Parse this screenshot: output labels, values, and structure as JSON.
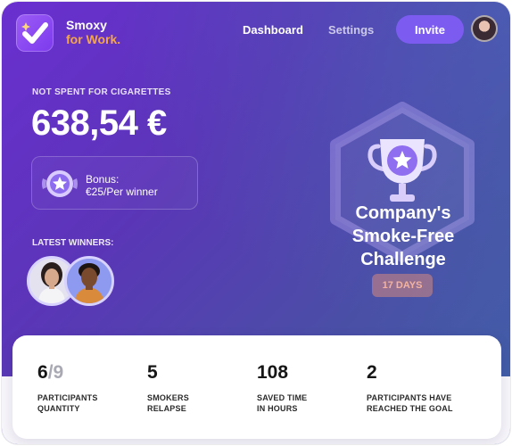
{
  "brand": {
    "name": "Smoxy",
    "sub": "for Work."
  },
  "nav": {
    "dashboard": "Dashboard",
    "settings": "Settings",
    "invite": "Invite"
  },
  "savings": {
    "label": "NOT SPENT FOR CIGARETTES",
    "amount": "638,54 €"
  },
  "bonus": {
    "title": "Bonus:",
    "value": "€25/Per winner"
  },
  "winners": {
    "label": "LATEST WINNERS:"
  },
  "challenge": {
    "title_1": "Company's",
    "title_2": "Smoke-Free",
    "title_3": "Challenge",
    "days": "17 DAYS"
  },
  "stats": [
    {
      "value": "6",
      "value_total": "/9",
      "label_1": "PARTICIPANTS",
      "label_2": "QUANTITY"
    },
    {
      "value": "5",
      "label_1": "SMOKERS",
      "label_2": "RELAPSE"
    },
    {
      "value": "108",
      "label_1": "SAVED TIME",
      "label_2": "IN HOURS"
    },
    {
      "value": "2",
      "label_1": "PARTICIPANTS HAVE",
      "label_2": "REACHED THE GOAL"
    }
  ],
  "colors": {
    "accent": "#7c5cf0",
    "brand_sub": "#f5a64a",
    "background_start": "#6a2fd0",
    "background_end": "#3f62a8"
  },
  "icons": [
    "app-logo-icon",
    "star-medal-icon",
    "trophy-icon",
    "hexagon-frame-icon"
  ]
}
